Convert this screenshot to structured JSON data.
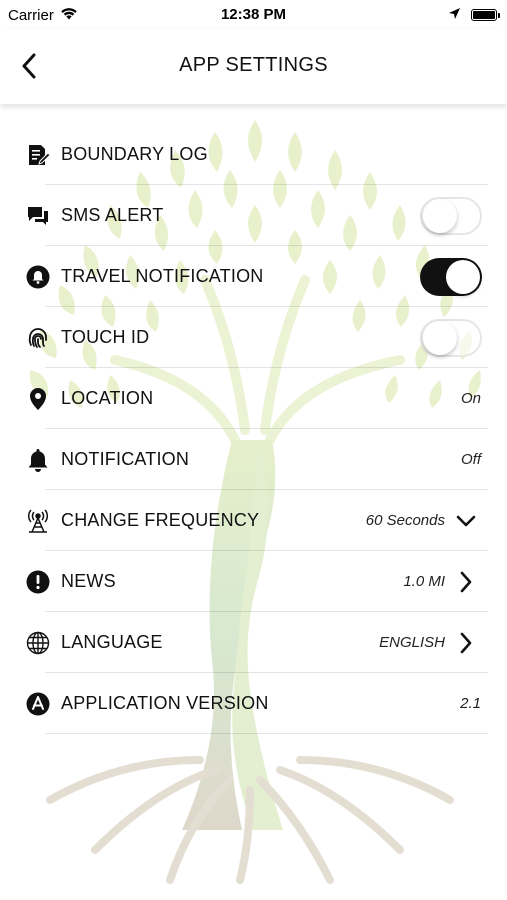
{
  "status_bar": {
    "carrier": "Carrier",
    "time": "12:38 PM"
  },
  "nav": {
    "title": "APP SETTINGS"
  },
  "settings": [
    {
      "label": "BOUNDARY LOG",
      "icon": "document-edit-icon"
    },
    {
      "label": "SMS ALERT",
      "icon": "chat-bubbles-icon",
      "toggle": "off"
    },
    {
      "label": "TRAVEL NOTIFICATION",
      "icon": "bell-circle-icon",
      "toggle": "on"
    },
    {
      "label": "TOUCH ID",
      "icon": "fingerprint-icon",
      "toggle": "off"
    },
    {
      "label": "LOCATION",
      "icon": "location-pin-icon",
      "value": "On"
    },
    {
      "label": "NOTIFICATION",
      "icon": "bell-icon",
      "value": "Off"
    },
    {
      "label": "CHANGE FREQUENCY",
      "icon": "antenna-tower-icon",
      "value": "60 Seconds"
    },
    {
      "label": "NEWS",
      "icon": "exclamation-circle-icon",
      "value": "1.0 MI"
    },
    {
      "label": "LANGUAGE",
      "icon": "globe-icon",
      "value": "ENGLISH"
    },
    {
      "label": "APPLICATION VERSION",
      "icon": "app-store-icon",
      "value": "2.1"
    }
  ],
  "colors": {
    "toggle_on": "#111111",
    "tree_leaves": "#c8de7a",
    "tree_trunk": "#b9aa88"
  }
}
